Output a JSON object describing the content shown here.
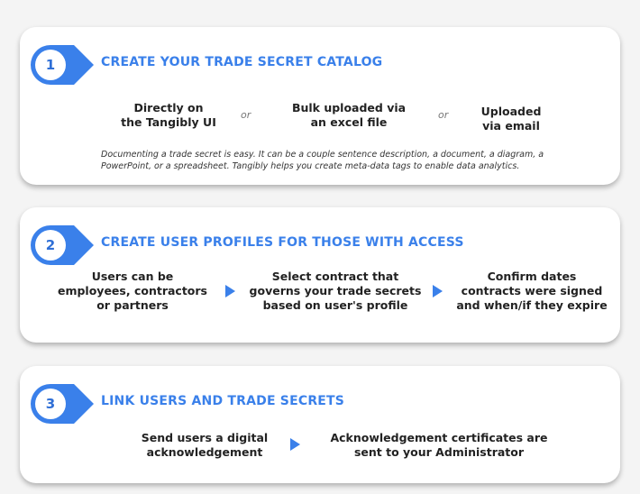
{
  "steps": [
    {
      "number": "1",
      "title": "CREATE YOUR TRADE SECRET CATALOG",
      "items": [
        "Directly on\nthe Tangibly UI",
        "Bulk uploaded via\nan excel file",
        "Uploaded\nvia email"
      ],
      "connector": "or",
      "note": "Documenting a trade secret is easy.  It can be a couple sentence description, a document, a diagram, a PowerPoint, or a spreadsheet. Tangibly helps you create meta-data tags to enable data analytics."
    },
    {
      "number": "2",
      "title": "CREATE USER PROFILES FOR THOSE WITH ACCESS",
      "items": [
        "Users can be\nemployees, contractors\nor partners",
        "Select contract that\ngoverns your trade secrets\nbased on user's profile",
        "Confirm dates\ncontracts were signed\nand when/if they expire"
      ]
    },
    {
      "number": "3",
      "title": "LINK USERS AND TRADE SECRETS",
      "items": [
        "Send users a digital\nacknowledgement",
        "Acknowledgement certificates are\nsent to your Administrator"
      ]
    }
  ],
  "colors": {
    "accent": "#3a80ea",
    "badge_text": "#2f6fd6"
  }
}
